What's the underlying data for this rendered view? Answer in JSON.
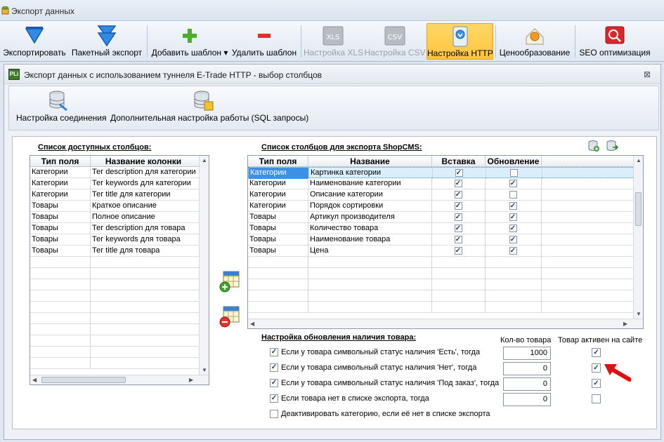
{
  "window": {
    "title": "Экспорт данных"
  },
  "ribbon": {
    "export": "Экспортировать",
    "batch_export": "Пакетный экспорт",
    "add_template": "Добавить шаблон",
    "delete_template": "Удалить шаблон",
    "xls_settings": "Настройка XLS",
    "csv_settings": "Настройка CSV",
    "http_settings": "Настройка HTTP",
    "pricing": "Ценообразование",
    "seo": "SEO оптимизация",
    "xls_badge": "XLS",
    "csv_badge": "CSV"
  },
  "child": {
    "title": "Экспорт данных с использованием туннеля E-Trade HTTP - выбор столбцов",
    "icon_text": "PLi",
    "close": "⊠",
    "toolbar": {
      "connection": "Настройка соединения",
      "sql": "Дополнительная настройка работы (SQL запросы)"
    }
  },
  "available": {
    "title": "Список доступных столбцов:",
    "headers": [
      "Тип поля",
      "Название колонки"
    ],
    "rows": [
      [
        "Категории",
        "Тег description для категории"
      ],
      [
        "Категории",
        "Тег keywords для категории"
      ],
      [
        "Категории",
        "Тег title для категории"
      ],
      [
        "Товары",
        "Краткое описание"
      ],
      [
        "Товары",
        "Полное описание"
      ],
      [
        "Товары",
        "Тег description для товара"
      ],
      [
        "Товары",
        "Тег keywords для товара"
      ],
      [
        "Товары",
        "Тег title для товара"
      ]
    ]
  },
  "export_cols": {
    "title": "Список столбцов для экспорта ShopCMS:",
    "headers": [
      "Тип поля",
      "Название",
      "Вставка",
      "Обновление"
    ],
    "rows": [
      {
        "type": "Категории",
        "name": "Картинка категории",
        "insert": true,
        "update": false,
        "selected": true
      },
      {
        "type": "Категории",
        "name": "Наименование категории",
        "insert": true,
        "update": true
      },
      {
        "type": "Категории",
        "name": "Описание категории",
        "insert": true,
        "update": false
      },
      {
        "type": "Категории",
        "name": "Порядок сортировки",
        "insert": true,
        "update": true
      },
      {
        "type": "Товары",
        "name": "Артикул производителя",
        "insert": true,
        "update": true
      },
      {
        "type": "Товары",
        "name": "Количество товара",
        "insert": true,
        "update": true
      },
      {
        "type": "Товары",
        "name": "Наименование товара",
        "insert": true,
        "update": true
      },
      {
        "type": "Товары",
        "name": "Цена",
        "insert": true,
        "update": true
      }
    ]
  },
  "stock": {
    "title": "Настройка обновления наличия товара:",
    "qty_header": "Кол-во товара",
    "active_header": "Товар активен на сайте",
    "lines": [
      {
        "label": "Если у товара символьный статус наличия 'Есть', тогда",
        "checked": true,
        "qty": "1000",
        "active": true
      },
      {
        "label": "Если у товара символьный статус наличия 'Нет', тогда",
        "checked": true,
        "qty": "0",
        "active": true
      },
      {
        "label": "Если у товара символьный статус наличия 'Под заказ', тогда",
        "checked": true,
        "qty": "0",
        "active": true
      },
      {
        "label": "Если товара нет в списке экспорта, тогда",
        "checked": true,
        "qty": "0",
        "active": false
      }
    ],
    "deactivate": "Деактивировать категорию, если её нет в списке экспорта"
  },
  "colors": {
    "accent": "#3c90e6",
    "active_button": "#ffc43d",
    "arrow_red": "#e01010"
  }
}
